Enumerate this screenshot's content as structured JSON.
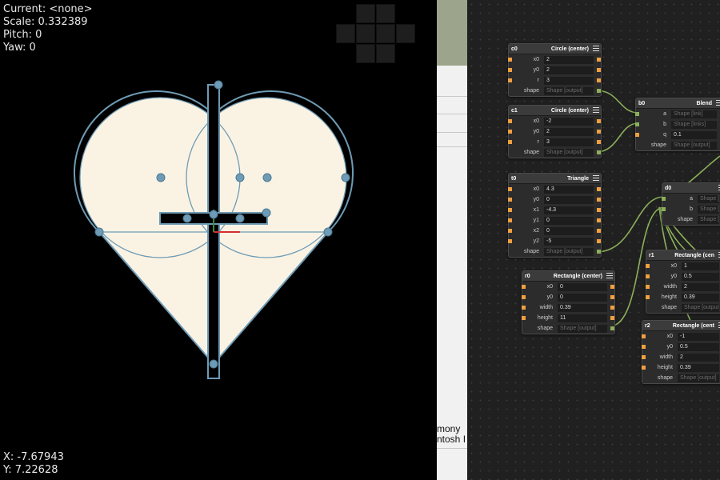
{
  "viewport": {
    "status": {
      "current": "Current: <none>",
      "scale": "Scale: 0.332389",
      "pitch": "Pitch: 0",
      "yaw": "Yaw: 0"
    },
    "cursor": {
      "x": "X: -7.67943",
      "y": "Y: 7.22628"
    },
    "colors": {
      "background": "#000000",
      "fill": "#faf3e4",
      "outline": "#6e9bb5"
    }
  },
  "middle_panel": {
    "fragment1": "mony",
    "fragment2": "ntosh I"
  },
  "graph": {
    "nodes": [
      {
        "id": "c0",
        "type": "Circle (center)",
        "rows": [
          {
            "label": "x0",
            "value": "2"
          },
          {
            "label": "y0",
            "value": "2"
          },
          {
            "label": "r",
            "value": "3"
          },
          {
            "label": "shape",
            "value": "Shape [output]",
            "placeholder": true
          }
        ]
      },
      {
        "id": "c1",
        "type": "Circle (center)",
        "rows": [
          {
            "label": "x0",
            "value": "-2"
          },
          {
            "label": "y0",
            "value": "2"
          },
          {
            "label": "r",
            "value": "3"
          },
          {
            "label": "shape",
            "value": "Shape [output]",
            "placeholder": true
          }
        ]
      },
      {
        "id": "b0",
        "type": "Blend",
        "rows": [
          {
            "label": "a",
            "value": "Shape [link]",
            "placeholder": true
          },
          {
            "label": "b",
            "value": "Shape [links]",
            "placeholder": true
          },
          {
            "label": "q",
            "value": "0.1"
          },
          {
            "label": "shape",
            "value": "Shape [output]",
            "placeholder": true
          }
        ]
      },
      {
        "id": "t0",
        "type": "Triangle",
        "rows": [
          {
            "label": "x0",
            "value": "4.3"
          },
          {
            "label": "y0",
            "value": "0"
          },
          {
            "label": "x1",
            "value": "-4.3"
          },
          {
            "label": "y1",
            "value": "0"
          },
          {
            "label": "x2",
            "value": "0"
          },
          {
            "label": "y2",
            "value": "-5"
          },
          {
            "label": "shape",
            "value": "Shape [output]",
            "placeholder": true
          }
        ]
      },
      {
        "id": "d0",
        "type": "",
        "rows": [
          {
            "label": "a",
            "value": "Shape [link]",
            "placeholder": true
          },
          {
            "label": "b",
            "value": "Shape [links]",
            "placeholder": true
          },
          {
            "label": "shape",
            "value": "Shape [output]",
            "placeholder": true
          }
        ]
      },
      {
        "id": "r0",
        "type": "Rectangle (center)",
        "rows": [
          {
            "label": "x0",
            "value": "0"
          },
          {
            "label": "y0",
            "value": "0"
          },
          {
            "label": "width",
            "value": "0.39"
          },
          {
            "label": "height",
            "value": "11"
          },
          {
            "label": "shape",
            "value": "Shape [output]",
            "placeholder": true
          }
        ]
      },
      {
        "id": "r1",
        "type": "Rectangle (cen",
        "rows": [
          {
            "label": "x0",
            "value": "1"
          },
          {
            "label": "y0",
            "value": "0.5"
          },
          {
            "label": "width",
            "value": "2"
          },
          {
            "label": "height",
            "value": "0.39"
          },
          {
            "label": "shape",
            "value": "Shape [output]",
            "placeholder": true
          }
        ]
      },
      {
        "id": "r2",
        "type": "Rectangle (cent",
        "rows": [
          {
            "label": "x0",
            "value": "-1"
          },
          {
            "label": "y0",
            "value": "0.5"
          },
          {
            "label": "width",
            "value": "2"
          },
          {
            "label": "height",
            "value": "0.39"
          },
          {
            "label": "shape",
            "value": "Shape [output]",
            "placeholder": true
          }
        ]
      }
    ],
    "colors": {
      "wire": "#8cb05a",
      "input_port": "#f0a040"
    }
  }
}
